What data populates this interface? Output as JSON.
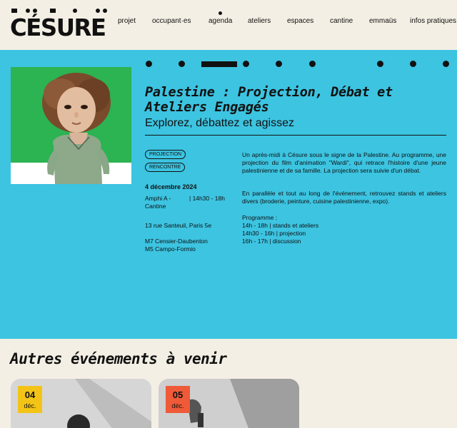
{
  "brand": {
    "logo_text": "CÉSURE"
  },
  "nav": {
    "items": [
      {
        "label": "projet"
      },
      {
        "label": "occupant·es"
      },
      {
        "label": "agenda"
      },
      {
        "label": "ateliers"
      },
      {
        "label": "espaces"
      },
      {
        "label": "cantine"
      },
      {
        "label": "emmaüs"
      },
      {
        "label": "infos pratiques"
      }
    ],
    "active": "agenda"
  },
  "event": {
    "title": "Palestine : Projection, Débat et Ateliers Engagés",
    "subtitle": "Explorez, débattez et agissez",
    "tags": [
      "PROJECTION",
      "RENCONTRE"
    ],
    "date": "4 décembre 2024",
    "location": "Amphi A - Cantine",
    "time": "| 14h30 - 18h",
    "address": "13 rue Santeuil, Paris 5e",
    "metro": [
      "M7 Censier-Daubenton",
      "M5 Campo-Formio"
    ],
    "description": [
      "Un après-midi à Césure sous le signe de la Palestine. Au programme, une projection du film d'animation \"Wardi\", qui retrace l'histoire d'une jeune palestinienne et de sa famille. La projection sera suivie d'un débat.",
      "En parallèle et tout au long de l'événement, retrouvez stands et ateliers divers (broderie, peinture, cuisine palestinienne, expo)."
    ],
    "programme_label": "Programme :",
    "programme": [
      "14h - 18h | stands et ateliers",
      "14h30 - 16h | projection",
      "16h - 17h | discussion"
    ]
  },
  "upcoming": {
    "title": "Autres événements à venir",
    "cards": [
      {
        "day": "04",
        "month": "déc.",
        "badge_color": "#f3c417"
      },
      {
        "day": "05",
        "month": "déc.",
        "badge_color": "#ef5a38"
      }
    ]
  },
  "colors": {
    "hero_bg": "#3cc4e1",
    "page_bg": "#f4efe4",
    "image_bg": "#2cb352"
  }
}
